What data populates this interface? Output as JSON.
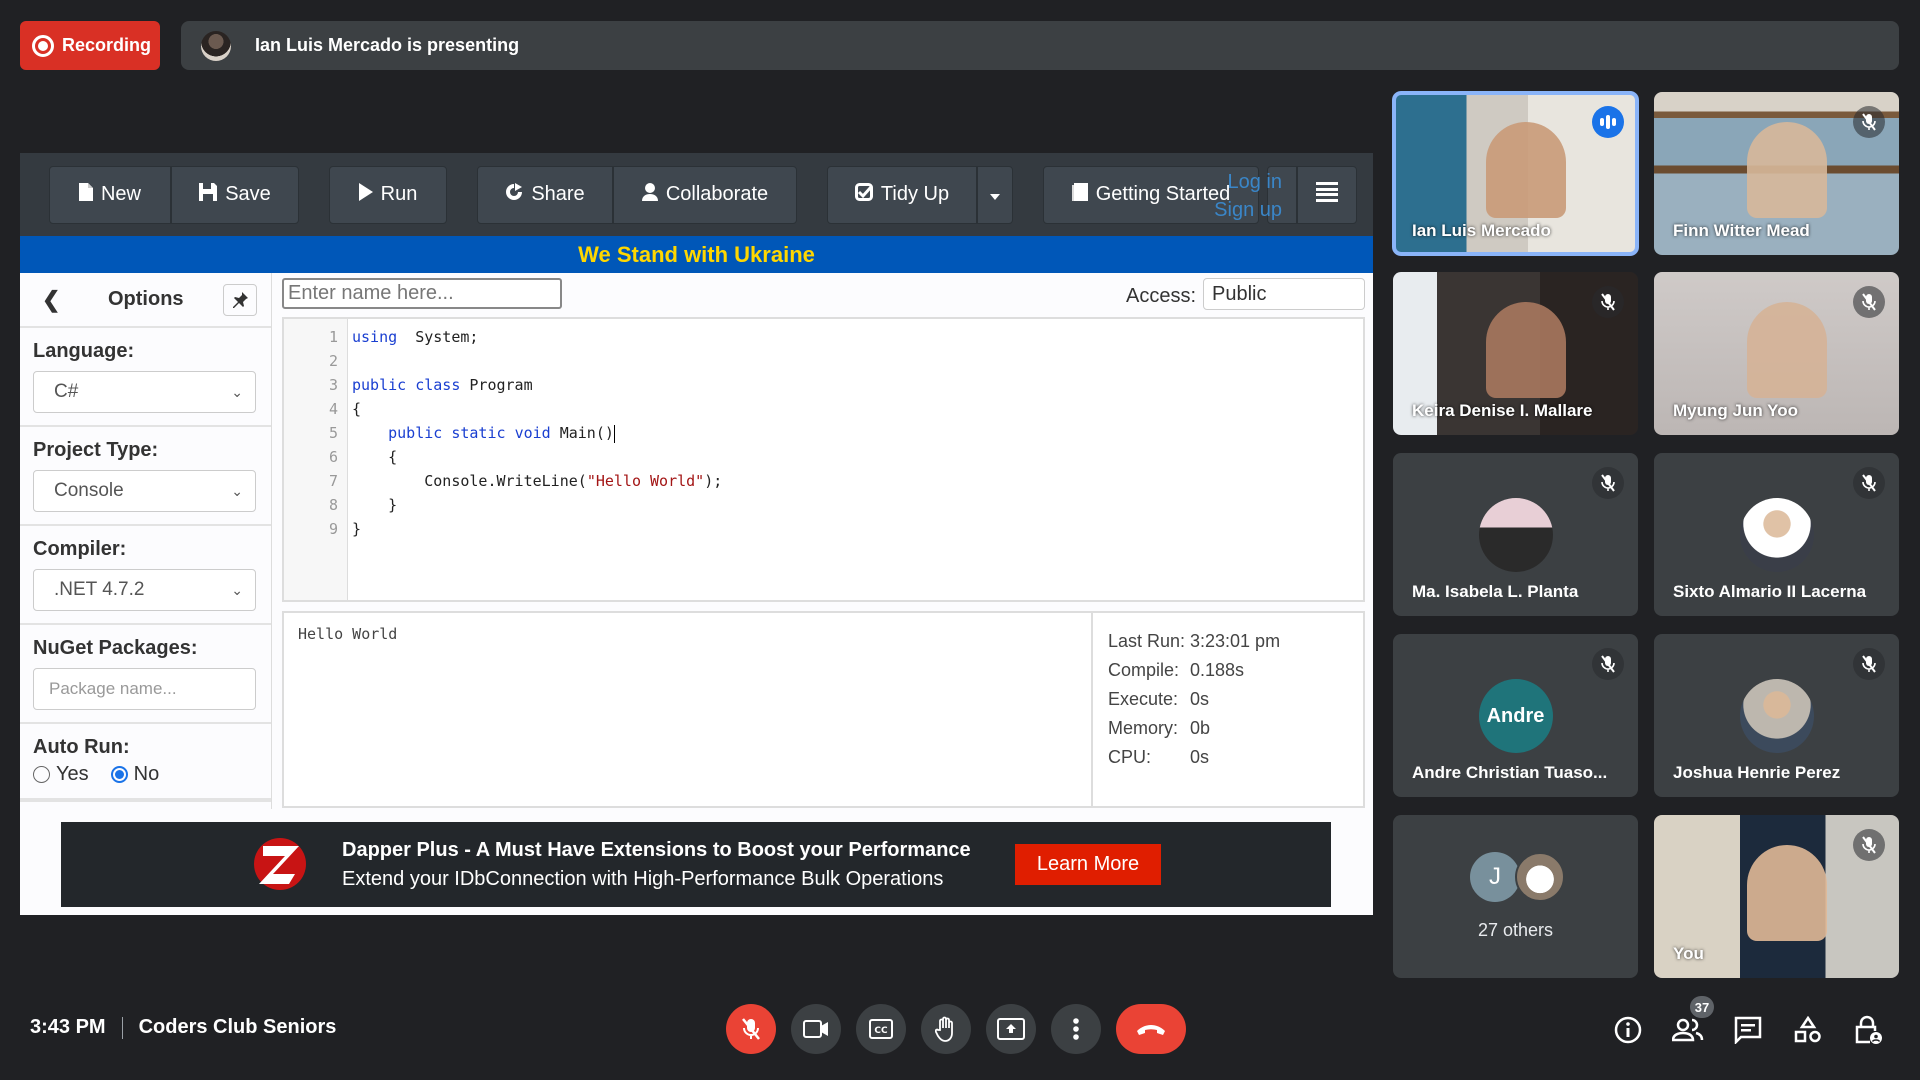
{
  "meet": {
    "recording_label": "Recording",
    "presenting_text": "Ian Luis Mercado is presenting",
    "time": "3:43 PM",
    "meeting_name": "Coders Club Seniors",
    "participant_count": "37",
    "colors": {
      "recording": "#d93025",
      "active_speaker": "#8ab4f8",
      "end_call": "#ea4335"
    }
  },
  "app": {
    "toolbar": {
      "new": "New",
      "save": "Save",
      "run": "Run",
      "share": "Share",
      "collaborate": "Collaborate",
      "tidy_up": "Tidy Up",
      "getting_started": "Getting Started",
      "login": "Log in",
      "signup": "Sign up"
    },
    "banner": "We Stand with Ukraine",
    "sidebar": {
      "title": "Options",
      "language_label": "Language:",
      "language_value": "C#",
      "project_type_label": "Project Type:",
      "project_type_value": "Console",
      "compiler_label": "Compiler:",
      "compiler_value": ".NET 4.7.2",
      "nuget_label": "NuGet Packages:",
      "nuget_placeholder": "Package name...",
      "autorun_label": "Auto Run:",
      "autorun_yes": "Yes",
      "autorun_no": "No",
      "autorun_selected": "No"
    },
    "name_placeholder": "Enter name here...",
    "access_label": "Access:",
    "access_value": "Public",
    "code_lines": [
      {
        "n": "1",
        "segs": [
          [
            "kw",
            "using"
          ],
          [
            "",
            "  System;"
          ]
        ]
      },
      {
        "n": "2",
        "segs": []
      },
      {
        "n": "3",
        "segs": [
          [
            "kw",
            "public"
          ],
          [
            "",
            " "
          ],
          [
            "kw",
            "class"
          ],
          [
            "",
            " Program"
          ]
        ]
      },
      {
        "n": "4",
        "segs": [
          [
            "",
            "{"
          ]
        ]
      },
      {
        "n": "5",
        "segs": [
          [
            "",
            "    "
          ],
          [
            "kw",
            "public"
          ],
          [
            "",
            " "
          ],
          [
            "kw",
            "static"
          ],
          [
            "",
            " "
          ],
          [
            "kw",
            "void"
          ],
          [
            "",
            " Main()"
          ]
        ]
      },
      {
        "n": "6",
        "segs": [
          [
            "",
            "    {"
          ]
        ]
      },
      {
        "n": "7",
        "segs": [
          [
            "",
            "        Console.WriteLine("
          ],
          [
            "str",
            "\"Hello World\""
          ],
          [
            "",
            ");"
          ]
        ]
      },
      {
        "n": "8",
        "segs": [
          [
            "",
            "    }"
          ]
        ]
      },
      {
        "n": "9",
        "segs": [
          [
            "",
            "}"
          ]
        ]
      }
    ],
    "output": "Hello World",
    "stats": [
      {
        "k": "Last Run:",
        "v": "3:23:01 pm"
      },
      {
        "k": "Compile:",
        "v": "0.188s"
      },
      {
        "k": "Execute:",
        "v": "0s"
      },
      {
        "k": "Memory:",
        "v": "0b"
      },
      {
        "k": "CPU:",
        "v": "0s"
      }
    ],
    "ad": {
      "title": "Dapper Plus - A Must Have Extensions to Boost your Performance",
      "subtitle": "Extend your IDbConnection with High-Performance Bulk Operations",
      "button": "Learn More"
    }
  },
  "participants": [
    {
      "name": "Ian Luis Mercado",
      "speaking": true
    },
    {
      "name": "Finn Witter Mead",
      "muted": true
    },
    {
      "name": "Keira Denise I. Mallare",
      "muted": true
    },
    {
      "name": "Myung Jun Yoo",
      "muted": true
    },
    {
      "name": "Ma. Isabela L. Planta",
      "muted": true
    },
    {
      "name": "Sixto Almario II Lacerna",
      "muted": true
    },
    {
      "name": "Andre Christian Tuaso...",
      "muted": true,
      "initials": "Andre"
    },
    {
      "name": "Joshua Henrie Perez",
      "muted": true
    },
    {
      "name": "27 others",
      "initial": "J"
    },
    {
      "name": "You",
      "muted": true
    }
  ]
}
